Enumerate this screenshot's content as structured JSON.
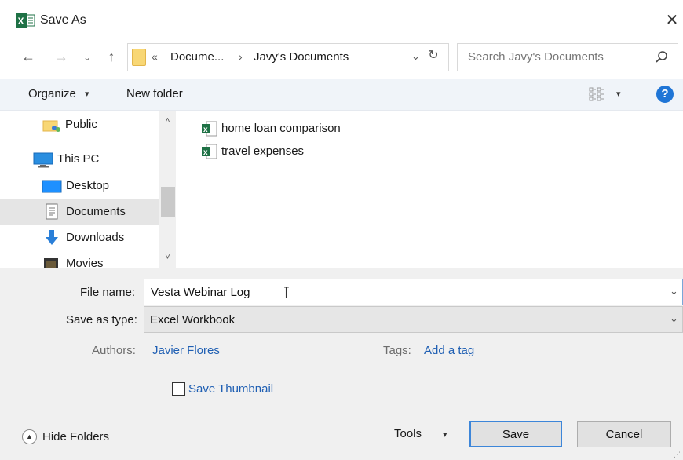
{
  "window": {
    "title": "Save As",
    "close_glyph": "✕",
    "app_icon": "excel-icon"
  },
  "nav": {
    "back_glyph": "←",
    "forward_glyph": "→",
    "recent_glyph": "⌄",
    "up_glyph": "↑"
  },
  "address": {
    "overflow_glyph": "«",
    "crumbs": [
      "Docume...",
      "Javy's Documents"
    ],
    "separator": "›",
    "dropdown_glyph": "⌄",
    "refresh_glyph": "↻"
  },
  "search": {
    "placeholder": "Search Javy's Documents"
  },
  "toolbar": {
    "organize_label": "Organize",
    "organize_caret": "▾",
    "new_folder_label": "New folder",
    "view_caret": "▾",
    "help_glyph": "?"
  },
  "sidebar": {
    "items": [
      {
        "label": "Public",
        "icon": "public-folder-icon",
        "selected": false
      },
      {
        "label": "This PC",
        "icon": "computer-icon",
        "selected": false
      },
      {
        "label": "Desktop",
        "icon": "desktop-icon",
        "selected": false
      },
      {
        "label": "Documents",
        "icon": "documents-icon",
        "selected": true
      },
      {
        "label": "Downloads",
        "icon": "downloads-icon",
        "selected": false
      },
      {
        "label": "Movies",
        "icon": "movies-icon",
        "selected": false
      }
    ],
    "scroll_up_glyph": "˄",
    "scroll_down_glyph": "˅"
  },
  "files": [
    {
      "name": "home loan comparison",
      "icon": "excel-file-icon"
    },
    {
      "name": "travel expenses",
      "icon": "excel-file-icon"
    }
  ],
  "form": {
    "file_name_label": "File name:",
    "file_name_value": "Vesta Webinar Log",
    "save_as_type_label": "Save as type:",
    "save_as_type_value": "Excel Workbook",
    "dropdown_glyph": "⌄",
    "authors_label": "Authors:",
    "authors_value": "Javier Flores",
    "tags_label": "Tags:",
    "tags_value": "Add a tag",
    "save_thumbnail_label": "Save Thumbnail",
    "save_thumbnail_checked": false
  },
  "footer": {
    "hide_folders_label": "Hide Folders",
    "hide_folders_glyph": "▲",
    "tools_label": "Tools",
    "tools_caret": "▾",
    "save_label": "Save",
    "cancel_label": "Cancel"
  },
  "colors": {
    "accent": "#1f75d6",
    "link": "#1f5fb3",
    "excel_green": "#1e7145",
    "selected_bg": "#e5e5e5"
  }
}
